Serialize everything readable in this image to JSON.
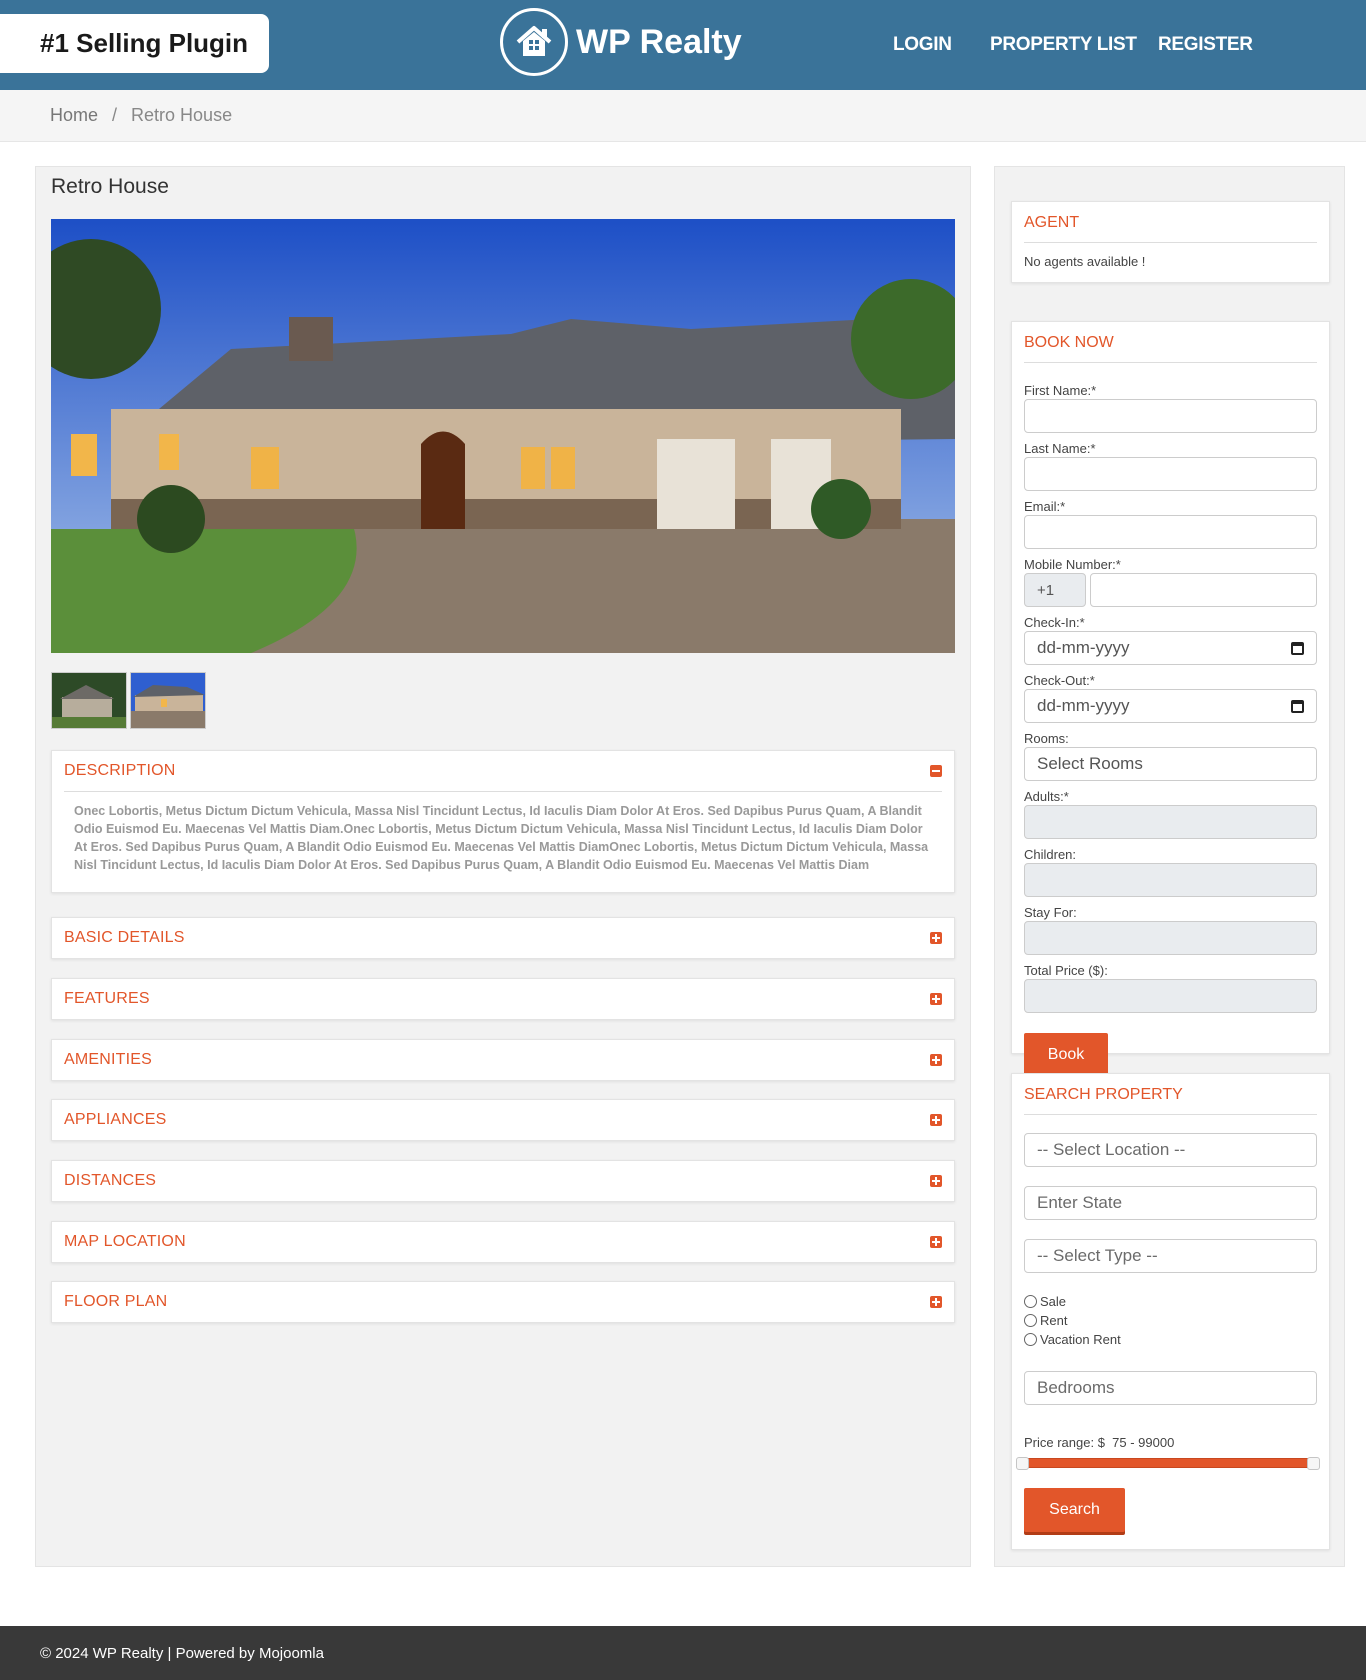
{
  "header": {
    "badge": "#1 Selling Plugin",
    "logo_text": "WP Realty",
    "nav": {
      "login": "LOGIN",
      "property_list": "PROPERTY LIST",
      "register": "REGISTER"
    }
  },
  "breadcrumb": {
    "home": "Home",
    "separator": "/",
    "current": "Retro House"
  },
  "property": {
    "title": "Retro House",
    "description_title": "DESCRIPTION",
    "description_text": "Onec Lobortis, Metus Dictum Dictum Vehicula, Massa Nisl Tincidunt Lectus, Id Iaculis Diam Dolor At Eros. Sed Dapibus Purus Quam, A Blandit Odio Euismod Eu. Maecenas Vel Mattis Diam.Onec Lobortis, Metus Dictum Dictum Vehicula, Massa Nisl Tincidunt Lectus, Id Iaculis Diam Dolor At Eros. Sed Dapibus Purus Quam, A Blandit Odio Euismod Eu. Maecenas Vel Mattis DiamOnec Lobortis, Metus Dictum Dictum Vehicula, Massa Nisl Tincidunt Lectus, Id Iaculis Diam Dolor At Eros. Sed Dapibus Purus Quam, A Blandit Odio Euismod Eu. Maecenas Vel Mattis Diam",
    "sections": [
      "BASIC DETAILS",
      "FEATURES",
      "AMENITIES",
      "APPLIANCES",
      "DISTANCES",
      "MAP LOCATION",
      "FLOOR PLAN"
    ]
  },
  "agent": {
    "title": "AGENT",
    "message": "No agents available !"
  },
  "booking": {
    "title": "BOOK NOW",
    "first_name": "First Name:*",
    "last_name": "Last Name:*",
    "email": "Email:*",
    "mobile": "Mobile Number:*",
    "phone_code": "+1",
    "check_in": "Check-In:*",
    "check_out": "Check-Out:*",
    "date_placeholder": "dd-mm-yyyy",
    "rooms": "Rooms:",
    "rooms_placeholder": "Select Rooms",
    "adults": "Adults:*",
    "children": "Children:",
    "stay_for": "Stay For:",
    "total_price": "Total Price ($):",
    "book_button": "Book"
  },
  "search": {
    "title": "SEARCH PROPERTY",
    "location_placeholder": "-- Select Location --",
    "state_placeholder": "Enter State",
    "type_placeholder": "-- Select Type --",
    "options": [
      "Sale",
      "Rent",
      "Vacation Rent"
    ],
    "bedrooms_placeholder": "Bedrooms",
    "price_range_label": "Price range: $",
    "price_range_value": "75 - 99000",
    "price_min": 75,
    "price_max": 99000,
    "search_button": "Search"
  },
  "footer": {
    "text": "© 2024 WP Realty  | Powered by Mojoomla"
  },
  "colors": {
    "header_bg": "#3a7399",
    "accent": "#e2562a",
    "footer_bg": "#393939"
  }
}
